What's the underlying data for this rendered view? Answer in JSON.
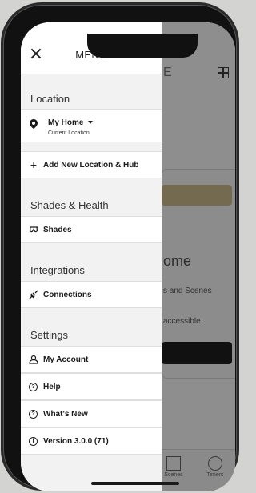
{
  "menu": {
    "title": "MENU",
    "sections": {
      "location": "Location",
      "shades_health": "Shades & Health",
      "integrations": "Integrations",
      "settings": "Settings"
    },
    "location_name": "My Home",
    "location_sub": "Current Location",
    "add_location": "Add New Location & Hub",
    "shades": "Shades",
    "connections": "Connections",
    "my_account": "My Account",
    "help": "Help",
    "whats_new": "What's New",
    "version": "Version 3.0.0 (71)"
  },
  "background": {
    "header_fragment": "E",
    "home_fragment": "ome",
    "text1_fragment": "s and Scenes",
    "text2_fragment": "accessible.",
    "tabs": [
      "Scenes",
      "Timers"
    ]
  },
  "icons": {
    "close": "close-icon",
    "pin": "location-pin-icon",
    "plus": "plus-icon",
    "shades": "shades-icon",
    "plug": "plug-icon",
    "user": "user-icon",
    "help": "question-circle-icon",
    "whats_new": "question-circle-icon",
    "info": "info-circle-icon",
    "grid": "grid-icon"
  }
}
